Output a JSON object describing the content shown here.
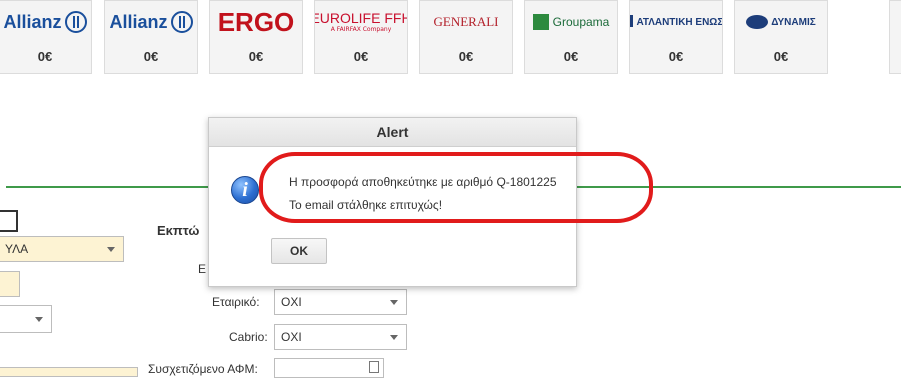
{
  "insurers": [
    {
      "name": "Allianz",
      "price": "0€",
      "logo_icon": "allianz-logo-icon"
    },
    {
      "name": "Allianz",
      "price": "0€",
      "logo_icon": "allianz-logo-icon"
    },
    {
      "name": "ERGO",
      "price": "0€",
      "logo_icon": "ergo-logo-icon"
    },
    {
      "name": "EUROLIFE FFH",
      "sub": "A FAIRFAX Company",
      "price": "0€",
      "logo_icon": "eurolife-logo-icon"
    },
    {
      "name": "GENERALI",
      "price": "0€",
      "logo_icon": "generali-logo-icon"
    },
    {
      "name": "Groupama",
      "price": "0€",
      "logo_icon": "groupama-logo-icon"
    },
    {
      "name": "ΑΤΛΑΝΤΙΚΗ ΕΝΩΣΗ",
      "price": "0€",
      "logo_icon": "atlantiki-logo-icon"
    },
    {
      "name": "ΔΥΝΑΜΙΣ",
      "price": "0€",
      "logo_icon": "dynamis-logo-icon"
    }
  ],
  "form": {
    "select_value": "ΥΛΑ",
    "section_heading": "Εκπτώ",
    "label_partial": "Ε",
    "etairiko_label": "Εταιρικό:",
    "etairiko_value": "ΟΧΙ",
    "cabrio_label": "Cabrio:",
    "cabrio_value": "ΟΧΙ",
    "afm_label": "Συσχετιζόμενο ΑΦΜ:"
  },
  "alert": {
    "title": "Alert",
    "message_line1": "Η προσφορά αποθηκεύτηκε με αριθμό Q-1801225",
    "message_line2": "Το email στάλθηκε επιτυχώς!",
    "ok_label": "OK",
    "icon": "info-icon"
  },
  "colors": {
    "green_rule": "#3f9a4a",
    "highlight": "#e11b1b",
    "field_yellow": "#fdf3d3"
  }
}
